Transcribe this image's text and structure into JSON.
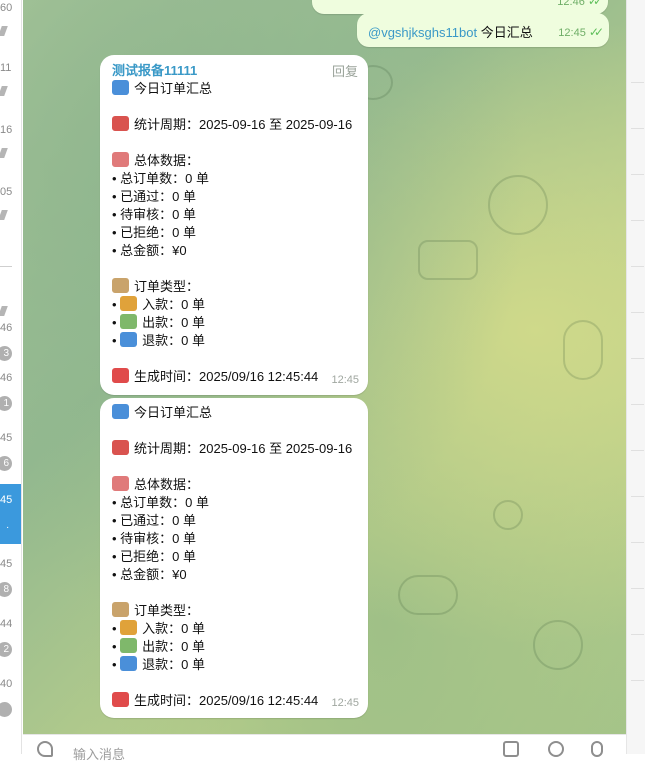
{
  "chatlist": {
    "rows": [
      {
        "time": "60",
        "marker": "pin"
      },
      {
        "time": "11",
        "marker": "pin"
      },
      {
        "time": "16",
        "marker": "pin"
      },
      {
        "time": "05",
        "marker": "pin"
      },
      {
        "time": "",
        "marker": "pin"
      },
      {
        "time": "46",
        "badge": "3"
      },
      {
        "time": "46",
        "badge": "1"
      },
      {
        "time": "45",
        "badge": "6"
      },
      {
        "time": "45",
        "badge": ".",
        "active": true
      },
      {
        "time": "45",
        "badge": "8"
      },
      {
        "time": "44",
        "badge": "2"
      },
      {
        "time": "40",
        "badge": ""
      }
    ],
    "fab_label": "测"
  },
  "messages_out": [
    {
      "text": "...",
      "time": "12:46",
      "ticks": "✓✓"
    },
    {
      "mention": "@vgshjksghs11bot",
      "text": " 今日汇总",
      "time": "12:45",
      "ticks": "✓✓"
    }
  ],
  "report": {
    "sender": "测试报备11111",
    "reply_label": "回复",
    "title": "今日订单汇总",
    "period_label": "统计周期：2025-09-16 至 2025-09-16",
    "overall_header": "总体数据：",
    "overall": [
      "• 总订单数：0 单",
      "• 已通过：0 单",
      "• 待审核：0 单",
      "• 已拒绝：0 单",
      "• 总金额：¥0"
    ],
    "types_header": "订单类型：",
    "types": [
      {
        "bullet": "• ",
        "icon": "money-bag-icon",
        "color": "#e0a23a",
        "text": "入款：0 单"
      },
      {
        "bullet": "• ",
        "icon": "money-wings-icon",
        "color": "#7fb86b",
        "text": "出款：0 单"
      },
      {
        "bullet": "• ",
        "icon": "refresh-icon",
        "color": "#4a8fd9",
        "text": "退款：0 单"
      }
    ],
    "generated_label": "生成时间：2025/09/16 12:45:44",
    "time": "12:45"
  },
  "composer": {
    "placeholder": "输入消息"
  },
  "colors": {
    "accent": "#3b99dd",
    "out_bubble": "#effdde",
    "sender": "#3a99c7",
    "tick": "#5fbf5b"
  }
}
